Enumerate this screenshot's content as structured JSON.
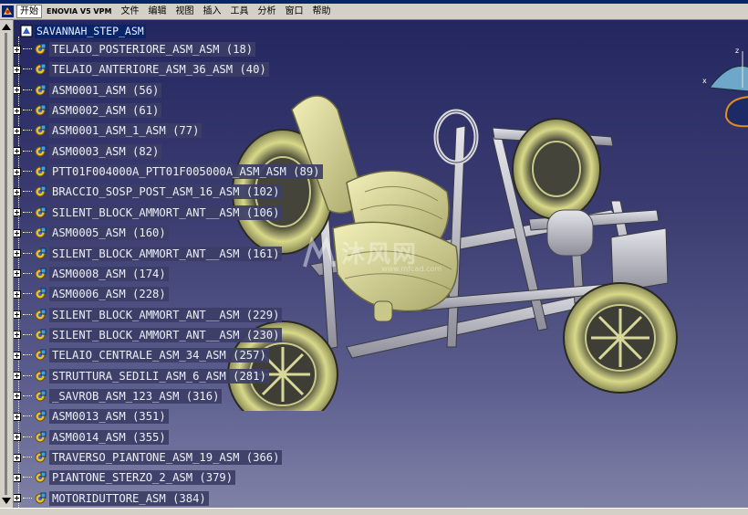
{
  "menubar": {
    "items": [
      "开始",
      "ENOVIA V5 VPM",
      "文件",
      "编辑",
      "视图",
      "插入",
      "工具",
      "分析",
      "窗口",
      "帮助"
    ]
  },
  "tree": {
    "root": "SAVANNAH_STEP_ASM",
    "items": [
      "TELAIO_POSTERIORE_ASM_ASM (18)",
      "TELAIO_ANTERIORE_ASM_36_ASM (40)",
      "ASM0001_ASM (56)",
      "ASM0002_ASM (61)",
      "ASM0001_ASM_1_ASM (77)",
      "ASM0003_ASM (82)",
      "PTT01F004000A_PTT01F005000A_ASM_ASM (89)",
      "BRACCIO_SOSP_POST_ASM_16_ASM (102)",
      "SILENT_BLOCK_AMMORT_ANT__ASM (106)",
      "ASM0005_ASM (160)",
      "SILENT_BLOCK_AMMORT_ANT__ASM (161)",
      "ASM0008_ASM (174)",
      "ASM0006_ASM (228)",
      "SILENT_BLOCK_AMMORT_ANT__ASM (229)",
      "SILENT_BLOCK_AMMORT_ANT__ASM (230)",
      "TELAIO_CENTRALE_ASM_34_ASM (257)",
      "STRUTTURA_SEDILI_ASM_6_ASM (281)",
      "_SAVROB_ASM_123_ASM (316)",
      "ASM0013_ASM (351)",
      "ASM0014_ASM (355)",
      "TRAVERSO_PIANTONE_ASM_19_ASM (366)",
      "PIANTONE_STERZO_2_ASM (379)",
      "MOTORIDUTTORE_ASM (384)"
    ]
  },
  "compass": {
    "x_label": "x",
    "z_label": "z"
  },
  "watermark": {
    "cn": "沐风网",
    "en": "www.mfcad.com"
  },
  "colors": {
    "selection": "#0a246a",
    "label_bg": "#3c3e66",
    "background_top": "#242660",
    "background_bottom": "#7f82a6"
  }
}
